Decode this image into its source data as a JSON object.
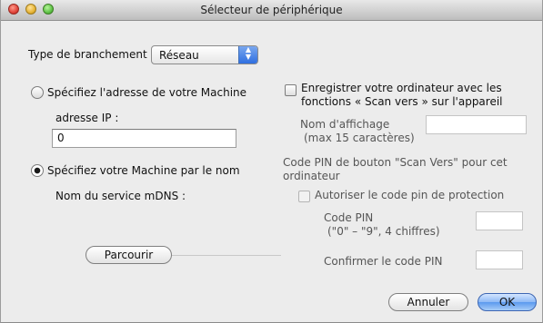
{
  "window": {
    "title": "Sélecteur de périphérique"
  },
  "connection": {
    "label": "Type de branchement",
    "selected": "Réseau"
  },
  "address_option": {
    "label": "Spécifiez l'adresse de votre Machine",
    "ip_label": "adresse IP :",
    "ip_value": "0",
    "checked": false
  },
  "name_option": {
    "label": "Spécifiez votre Machine par le nom",
    "mdns_label": "Nom du service mDNS :",
    "checked": true,
    "browse_button": "Parcourir"
  },
  "scan_to": {
    "register_line1": "Enregistrer votre ordinateur avec les",
    "register_line2": "fonctions « Scan vers » sur l'appareil",
    "display_name_line1": "Nom d'affichage",
    "display_name_line2": "(max 15 caractères)",
    "display_name_value": "",
    "pin_heading_line1": "Code PIN de bouton \"Scan Vers\" pour cet",
    "pin_heading_line2": "ordinateur",
    "protect_label": "Autoriser le code pin de protection",
    "pin_label_line1": "Code PIN",
    "pin_label_line2": "(\"0\" – \"9\", 4 chiffres)",
    "pin_value": "",
    "confirm_label": "Confirmer le code PIN",
    "confirm_value": ""
  },
  "footer": {
    "cancel_button": "Annuler",
    "ok_button": "OK"
  }
}
